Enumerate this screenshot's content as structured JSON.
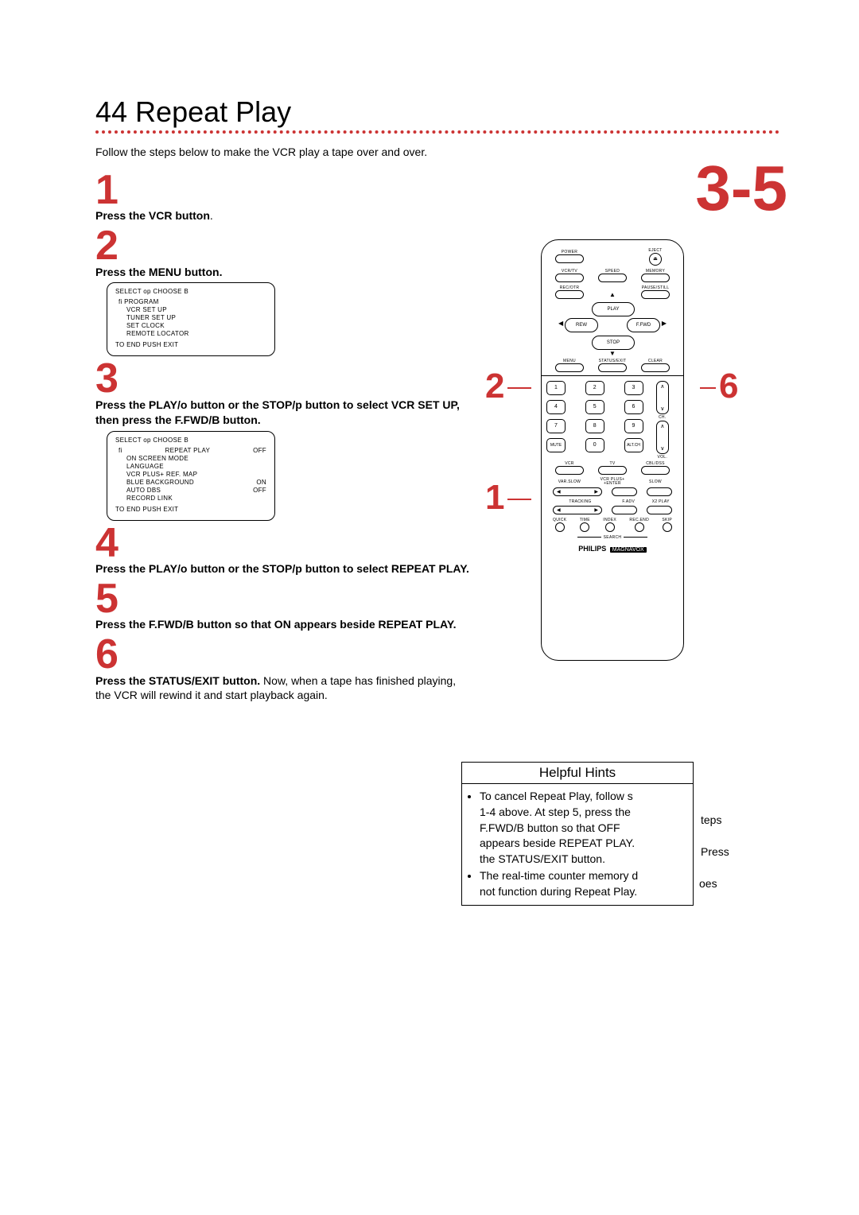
{
  "pageNumber": "44",
  "pageTitle": "Repeat Play",
  "intro": "Follow the steps below to make the VCR play a tape over and over.",
  "bigCallout": "3-5",
  "callouts": {
    "left": "2",
    "middle": "1",
    "right": "6"
  },
  "steps": {
    "s1": {
      "num": "1",
      "line1": "Press the VCR button",
      "tail": "."
    },
    "s2": {
      "num": "2",
      "line1": "Press the MENU button."
    },
    "s3": {
      "num": "3",
      "line1a": "Press the PLAY/",
      "line1b": "o",
      "line1c": " button or the STOP/",
      "line1d": "p",
      "line1e": " button to select VCR SET UP, then press the F.FWD/",
      "line1f": "B",
      "line1g": " button."
    },
    "s4": {
      "num": "4",
      "line1a": "Press the PLAY/",
      "line1b": "o",
      "line1c": " button or the STOP/",
      "line1d": "p",
      "line1e": " button to select REPEAT PLAY."
    },
    "s5": {
      "num": "5",
      "line1a": "Press the F.FWD/",
      "line1b": "B",
      "line1c": " button so that ON appears beside REPEAT PLAY."
    },
    "s6": {
      "num": "6",
      "line1a": "Press the STATUS/EXIT button.",
      "line1b": " Now, when a tape has finished playing, the VCR will rewind it and start playback again."
    }
  },
  "osd1": {
    "head": "SELECT op    CHOOSE B",
    "items": [
      "PROGRAM",
      "VCR SET UP",
      "TUNER SET UP",
      "SET CLOCK",
      "REMOTE LOCATOR"
    ],
    "foot": "TO END PUSH EXIT"
  },
  "osd2": {
    "head": "SELECT op    CHOOSE B",
    "items": [
      {
        "l": "REPEAT PLAY",
        "r": "OFF"
      },
      {
        "l": "ON SCREEN MODE",
        "r": ""
      },
      {
        "l": "LANGUAGE",
        "r": ""
      },
      {
        "l": "VCR PLUS+ REF. MAP",
        "r": ""
      },
      {
        "l": "BLUE BACKGROUND",
        "r": "ON"
      },
      {
        "l": "AUTO DBS",
        "r": "OFF"
      },
      {
        "l": "RECORD LINK",
        "r": ""
      }
    ],
    "foot": "TO END PUSH EXIT"
  },
  "remote": {
    "row1": {
      "power": "POWER",
      "eject": "EJECT"
    },
    "row2": {
      "vcrtv": "VCR/TV",
      "speed": "SPEED",
      "memory": "MEMORY"
    },
    "row3": {
      "recotr": "REC/OTR",
      "pausestill": "PAUSE/STILL"
    },
    "dpad": {
      "play": "PLAY",
      "rew": "REW",
      "ffwd": "F.FWD",
      "stop": "STOP"
    },
    "row5": {
      "menu": "MENU",
      "status": "STATUS/EXIT",
      "clear": "CLEAR"
    },
    "numpad": [
      "1",
      "2",
      "3",
      "4",
      "5",
      "6",
      "7",
      "8",
      "9",
      "0"
    ],
    "mute": "MUTE",
    "altch": "ALT.CH",
    "ch": "CH.",
    "vol": "VOL.",
    "row7": {
      "vcr": "VCR",
      "tv": "TV",
      "cbl": "CBL/DSS"
    },
    "row8": {
      "varslow": "VAR.SLOW",
      "vcrplus": "VCR PLUS+\n+ENTER",
      "slow": "SLOW"
    },
    "row9": {
      "tracking": "TRACKING",
      "fadv": "F.ADV",
      "x2": "X2 PLAY"
    },
    "row10": [
      "QUICK",
      "TIME",
      "INDEX",
      "REC.END",
      "SKIP"
    ],
    "search": "SEARCH",
    "brand1": "PHILIPS",
    "brand2": "MAGNAVOX"
  },
  "hints": {
    "title": "Helpful Hints",
    "b1a": "To cancel Repeat Play, follow s",
    "b1a_over": "teps",
    "b1b": "1-4 above. At step 5, press the",
    "b1c_a": "F.FWD/",
    "b1c_b": "B",
    "b1c_c": " button so that OFF",
    "b1d": "appears beside REPEAT PLAY.",
    "b1d_over": " Press",
    "b1e": "the STATUS/EXIT button.",
    "b2a": "The real-time counter memory d",
    "b2a_over": "oes",
    "b2b": "not function during Repeat Play.",
    "b2b_over": ""
  }
}
